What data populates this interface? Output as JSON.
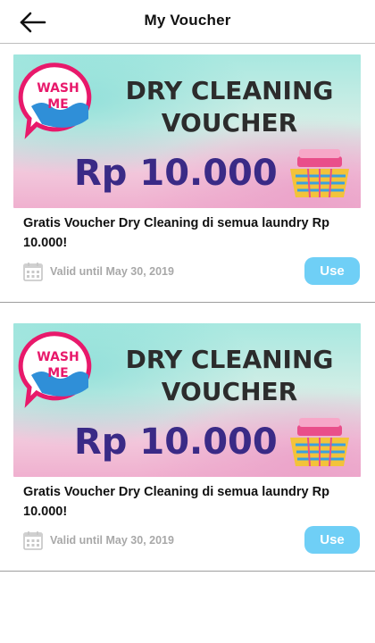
{
  "header": {
    "title": "My Voucher",
    "back_icon": "arrow-left-icon"
  },
  "vouchers": [
    {
      "banner": {
        "logo_line1": "WASH",
        "logo_line2": "ME",
        "heading_line1": "DRY CLEANING",
        "heading_line2": "VOUCHER",
        "amount": "Rp 10.000"
      },
      "description": "Gratis Voucher Dry Cleaning di semua laundry Rp 10.000!",
      "valid_text": "Valid until May 30, 2019",
      "use_label": "Use"
    },
    {
      "banner": {
        "logo_line1": "WASH",
        "logo_line2": "ME",
        "heading_line1": "DRY CLEANING",
        "heading_line2": "VOUCHER",
        "amount": "Rp 10.000"
      },
      "description": "Gratis Voucher Dry Cleaning di semua laundry Rp 10.000!",
      "valid_text": "Valid until May 30, 2019",
      "use_label": "Use"
    }
  ],
  "colors": {
    "accent": "#6fcff6",
    "logo_pink": "#e8196b",
    "amount_purple": "#3a2a86",
    "divider": "#9e9e9e"
  }
}
